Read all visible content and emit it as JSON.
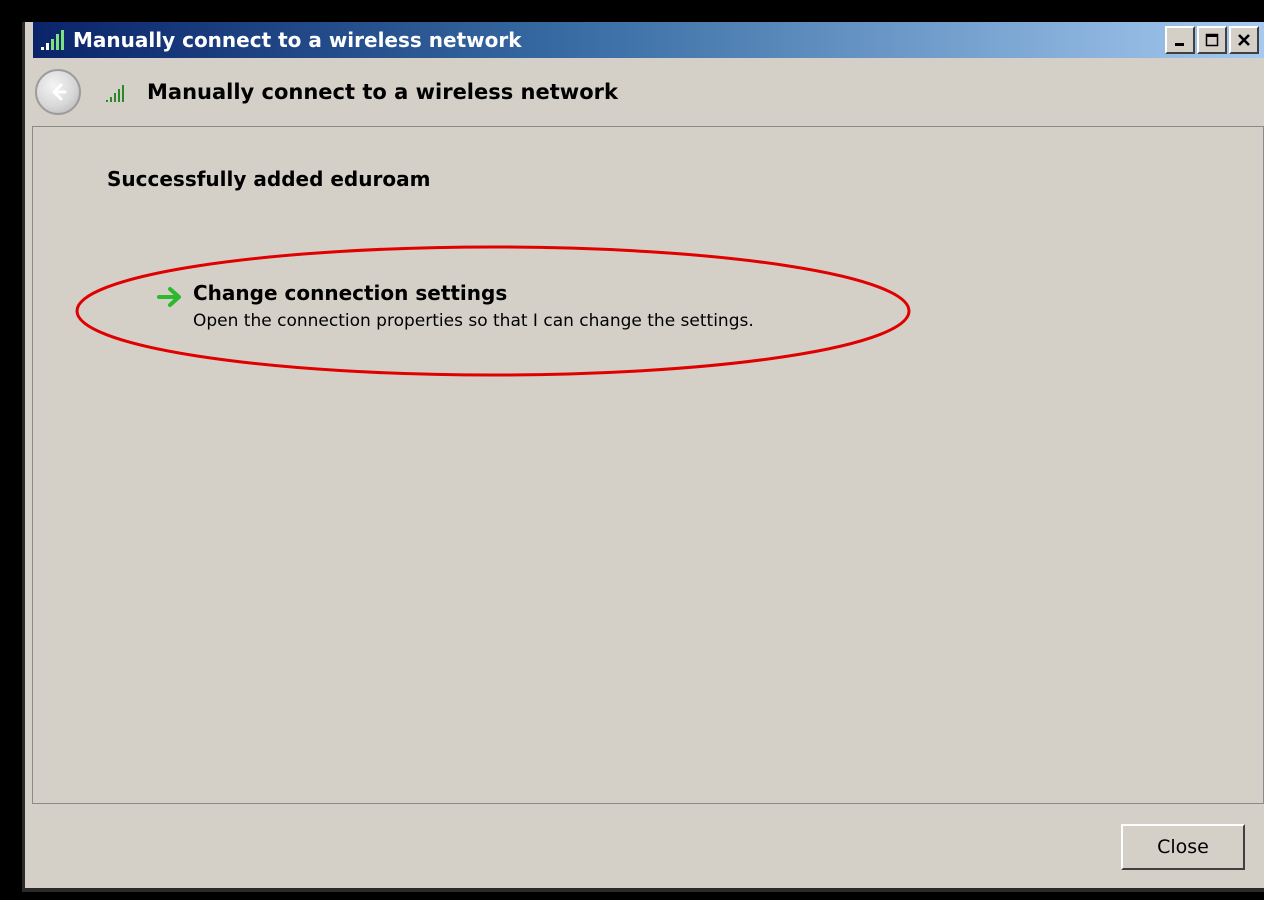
{
  "window": {
    "title": "Manually connect to a wireless network",
    "controls": {
      "minimize_icon": "minimize-icon",
      "maximize_icon": "maximize-icon",
      "close_icon": "close-icon"
    }
  },
  "header": {
    "back_icon": "back-arrow-icon",
    "wifi_icon": "wireless-signal-icon",
    "title": "Manually connect to a wireless network"
  },
  "content": {
    "success_message": "Successfully added eduroam",
    "change_settings": {
      "icon": "green-arrow-icon",
      "title": "Change connection settings",
      "description": "Open the connection properties so that I can change the settings."
    }
  },
  "footer": {
    "close_label": "Close"
  },
  "colors": {
    "window_bg": "#d4d0c8",
    "titlebar_start": "#0a246a",
    "titlebar_end": "#a6caf0",
    "annotation": "#e00000",
    "arrow_green": "#2eb82e"
  }
}
